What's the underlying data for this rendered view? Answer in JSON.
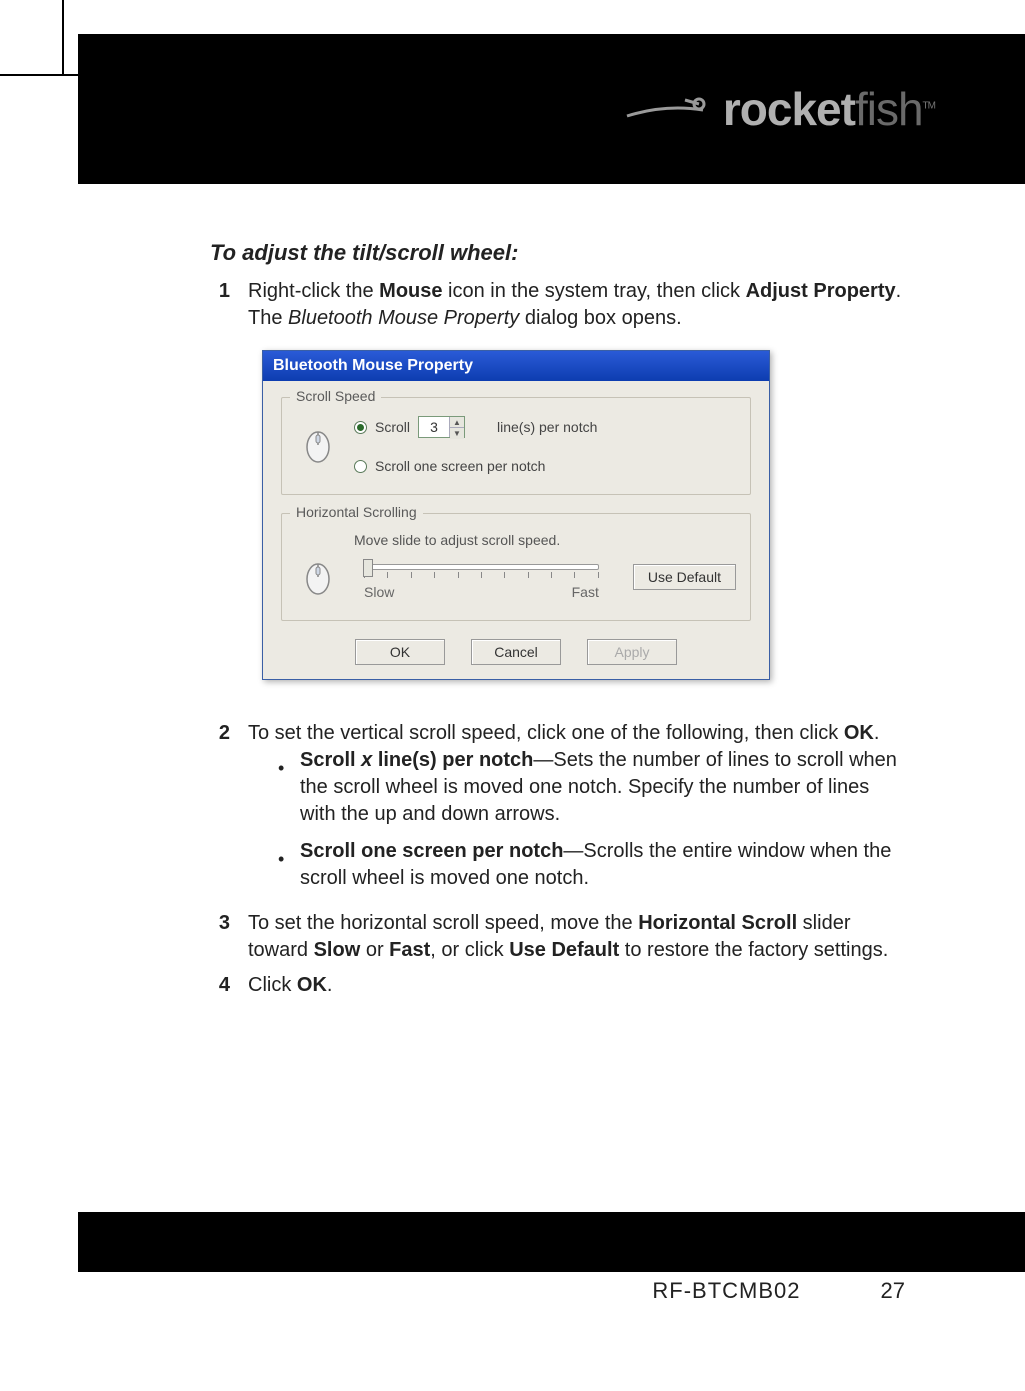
{
  "brand": {
    "name_part1": "rocket",
    "name_part2": "fish",
    "tm": "TM"
  },
  "section_title": "To adjust the tilt/scroll wheel:",
  "steps": {
    "s1": {
      "num": "1",
      "pre": "Right-click the ",
      "mouse": "Mouse",
      "mid": " icon in the system tray, then click ",
      "adjust": "Adjust Property",
      "post1": ". The ",
      "dlgname": "Bluetooth Mouse Property",
      "post2": " dialog box opens."
    },
    "s2": {
      "num": "2",
      "text_pre": "To set the vertical scroll speed, click one of the following, then click ",
      "ok": "OK",
      "text_post": ".",
      "b1": {
        "label": "Scroll x line(s) per notch",
        "x": "x",
        "desc": "—Sets the number of lines to scroll when the scroll wheel is moved one notch. Specify the number of lines with the up and down arrows."
      },
      "b2": {
        "label": "Scroll one screen per notch",
        "desc": "—Scrolls the entire window when the scroll wheel is moved one notch."
      }
    },
    "s3": {
      "num": "3",
      "pre": "To set the horizontal scroll speed, move the ",
      "hs": "Horizontal Scroll",
      "mid1": " slider toward ",
      "slow": "Slow",
      "mid2": " or ",
      "fast": "Fast",
      "mid3": ", or click ",
      "ud": "Use Default",
      "post": " to restore the factory settings."
    },
    "s4": {
      "num": "4",
      "pre": "Click ",
      "ok": "OK",
      "post": "."
    }
  },
  "dialog": {
    "title": "Bluetooth Mouse Property",
    "scroll_speed": {
      "legend": "Scroll Speed",
      "radio_scroll_label": "Scroll",
      "lines_value": "3",
      "lines_suffix": "line(s) per notch",
      "radio_screen_label": "Scroll one screen per notch"
    },
    "horizontal": {
      "legend": "Horizontal Scrolling",
      "instruction": "Move slide to adjust scroll speed.",
      "slow": "Slow",
      "fast": "Fast",
      "use_default": "Use Default"
    },
    "buttons": {
      "ok": "OK",
      "cancel": "Cancel",
      "apply": "Apply"
    }
  },
  "footer": {
    "model": "RF-BTCMB02",
    "page": "27"
  }
}
